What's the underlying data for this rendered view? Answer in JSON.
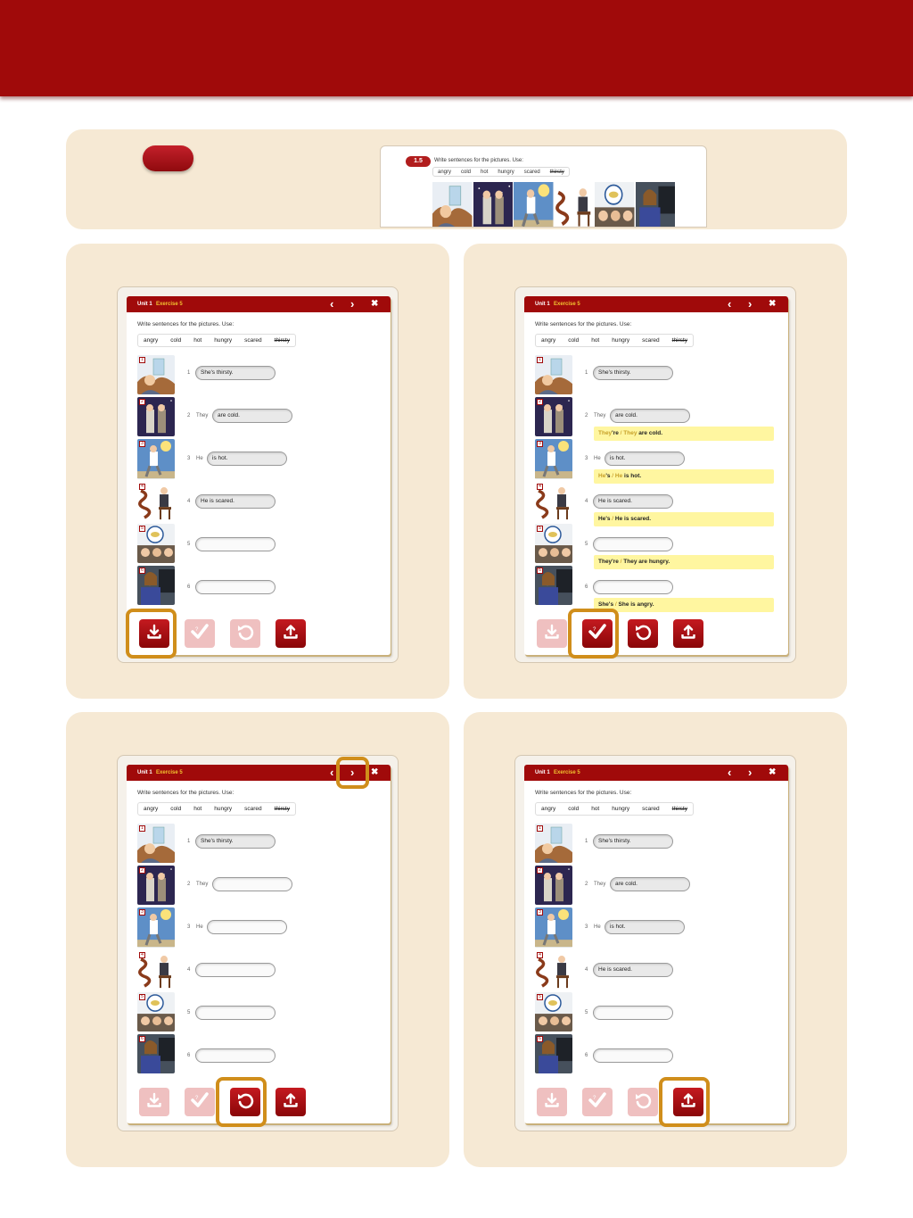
{
  "exercise": {
    "unit": "Unit 1",
    "exercise": "Exercise 5",
    "instruction": "Write sentences for the pictures. Use:",
    "words": [
      "angry",
      "cold",
      "hot",
      "hungry",
      "scared",
      "thirsty"
    ],
    "struck_word": "thirsty",
    "prefixes": [
      "",
      "They",
      "He",
      "",
      "",
      ""
    ]
  },
  "preview": {
    "badge": "1.5",
    "instruction": "Write sentences for the pictures. Use:",
    "words": [
      "angry",
      "cold",
      "hot",
      "hungry",
      "scared",
      "thirsty"
    ]
  },
  "colors": {
    "brand_red": "#a00a0a",
    "highlight": "#d08e1b",
    "answer_bg": "#fff6a0",
    "panel": "#f6e9d4"
  },
  "icons": [
    "download-icon",
    "check-icon",
    "undo-icon",
    "upload-icon",
    "chevron-left-icon",
    "chevron-right-icon",
    "close-icon"
  ],
  "panels": [
    {
      "name": "download",
      "answers": [
        "She's thirsty.",
        "are cold.",
        "is hot.",
        "He is scared.",
        "",
        ""
      ],
      "feedback": [],
      "highlight": "download"
    },
    {
      "name": "check",
      "answers": [
        "She's thirsty.",
        "are cold.",
        "is hot.",
        "He is scared.",
        "",
        ""
      ],
      "feedback": [
        {
          "row": 2,
          "a": "They",
          "b": "'re",
          "c": "They",
          "rest": " are cold."
        },
        {
          "row": 3,
          "a": "He",
          "b": "'s",
          "c": "He",
          "rest": " is hot."
        },
        {
          "row": 4,
          "a": "He",
          "b": "'s",
          "c": "He",
          "rest": " is scared."
        },
        {
          "row": 5,
          "a": "They",
          "b": "'re",
          "c": "They",
          "rest": " are hungry."
        },
        {
          "row": 6,
          "a": "She",
          "b": "'s",
          "c": "She",
          "rest": " is angry."
        }
      ],
      "highlight": "check"
    },
    {
      "name": "reset",
      "answers": [
        "She's thirsty.",
        "",
        "",
        "",
        "",
        ""
      ],
      "feedback": [],
      "highlight": "reset"
    },
    {
      "name": "upload",
      "answers": [
        "She's thirsty.",
        "are cold.",
        "is hot.",
        "He is scared.",
        "",
        ""
      ],
      "feedback": [],
      "highlight": "upload"
    }
  ]
}
